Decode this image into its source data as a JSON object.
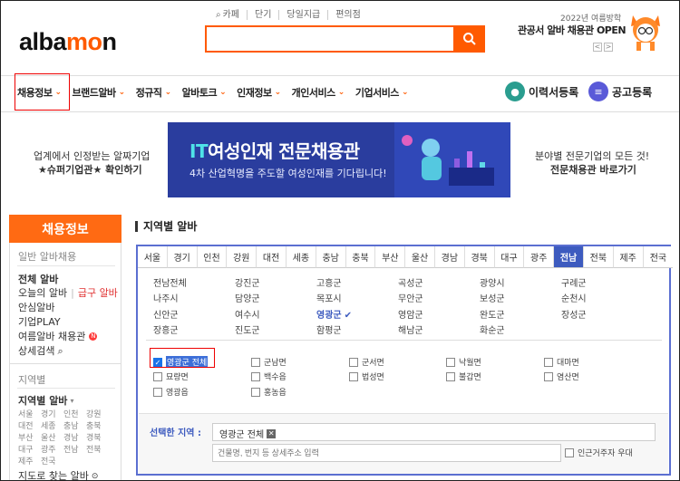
{
  "header": {
    "logo": {
      "pre": "alba",
      "o": "m",
      "post": "n"
    },
    "top_links": [
      "카페",
      "단기",
      "당일지급",
      "편의점"
    ],
    "search_placeholder": "",
    "promo_line1": "2022년 여름방학",
    "promo_line2": "관공서 알바 채용관 OPEN",
    "promo_prev": "<",
    "promo_next": ">"
  },
  "nav": {
    "items": [
      "채용정보",
      "브랜드알바",
      "정규직",
      "알바토크",
      "인재정보",
      "개인서비스",
      "기업서비스"
    ],
    "resume_label": "이력서등록",
    "job_post_label": "공고등록"
  },
  "banner": {
    "left_line1": "업계에서 인정받는 알짜기업",
    "left_line2": "★슈퍼기업관★ 확인하기",
    "title_it": "IT",
    "title_rest": "여성인재 전문채용관",
    "subtitle": "4차 산업혁명을 주도할 여성인재를 기다립니다!",
    "right_line1": "분야별 전문기업의 모든 것!",
    "right_line2": "전문채용관 바로가기"
  },
  "sidebar": {
    "head": "채용정보",
    "section1": "일반 알바채용",
    "items": [
      "전체 알바",
      "오늘의 알바",
      "급구 알바",
      "안심알바",
      "기업PLAY",
      "여름알바 채용관",
      "상세검색"
    ],
    "section2": "지역별",
    "region_title": "지역별 알바",
    "regions": [
      "서울",
      "경기",
      "인천",
      "강원",
      "대전",
      "세종",
      "충남",
      "충북",
      "부산",
      "울산",
      "경남",
      "경북",
      "대구",
      "광주",
      "전남",
      "전북",
      "제주",
      "전국"
    ],
    "map_link": "지도로 찾는 알바"
  },
  "content": {
    "section_title": "지역별 알바",
    "tabs": [
      "서울",
      "경기",
      "인천",
      "강원",
      "대전",
      "세종",
      "충남",
      "충북",
      "부산",
      "울산",
      "경남",
      "경북",
      "대구",
      "광주",
      "전남",
      "전북",
      "제주",
      "전국"
    ],
    "selected_tab": "전남",
    "counties": [
      "전남전체",
      "강진군",
      "고흥군",
      "곡성군",
      "광양시",
      "구례군",
      "나주시",
      "담양군",
      "목포시",
      "무안군",
      "보성군",
      "순천시",
      "신안군",
      "여수시",
      "영광군",
      "영암군",
      "완도군",
      "장성군",
      "장흥군",
      "진도군",
      "함평군",
      "해남군",
      "화순군"
    ],
    "selected_county": "영광군",
    "towns": [
      "영광군 전체",
      "군남면",
      "군서면",
      "낙월면",
      "대마면",
      "묘량면",
      "백수읍",
      "법성면",
      "불갑면",
      "염산면",
      "영광읍",
      "홍농읍"
    ],
    "checked_town": "영광군 전체",
    "selected_label": "선택한 지역 :",
    "selected_chip": "영광군 전체",
    "chip_remove": "✕",
    "address_placeholder": "건물명, 번지 등 상세주소 입력",
    "near_label": "인근거주자 우대"
  },
  "colors": {
    "brand": "#ff5a00",
    "accent_blue": "#3d5bbf"
  }
}
